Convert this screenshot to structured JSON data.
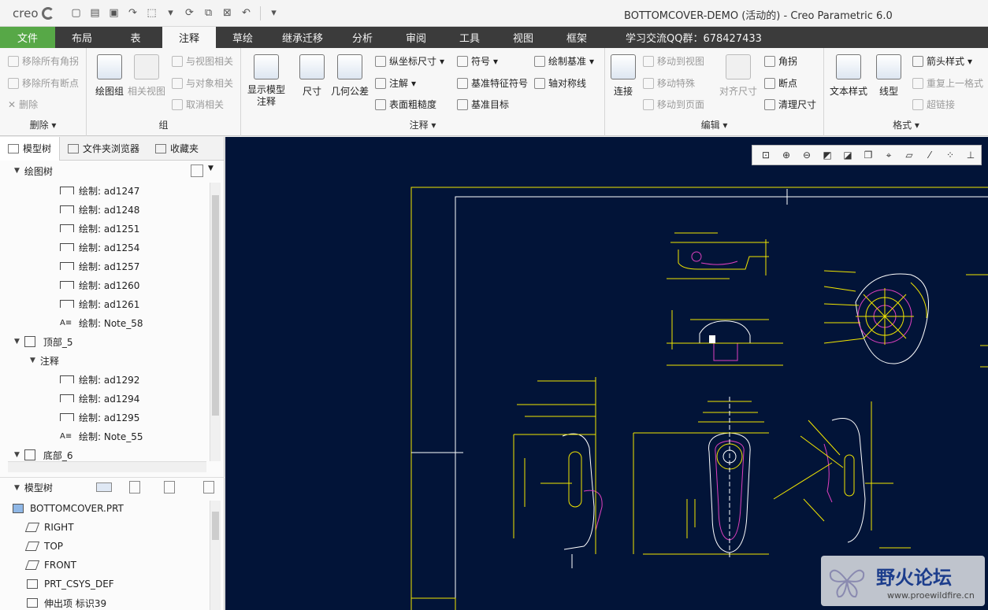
{
  "titlebar": {
    "logo": "creo",
    "title": "BOTTOMCOVER-DEMO (活动的) - Creo Parametric 6.0"
  },
  "tabs": [
    {
      "label": "文件"
    },
    {
      "label": "布局"
    },
    {
      "label": "表"
    },
    {
      "label": "注释"
    },
    {
      "label": "草绘"
    },
    {
      "label": "继承迁移"
    },
    {
      "label": "分析"
    },
    {
      "label": "审阅"
    },
    {
      "label": "工具"
    },
    {
      "label": "视图"
    },
    {
      "label": "框架"
    }
  ],
  "qq_group": "学习交流QQ群：678427433",
  "ribbon": {
    "delete": {
      "label": "删除",
      "items": [
        "移除所有角拐",
        "移除所有断点",
        "删除"
      ]
    },
    "group": {
      "label": "组",
      "draw_group": "绘图组",
      "related_view": "相关视图",
      "items": [
        "与视图相关",
        "与对象相关",
        "取消相关"
      ]
    },
    "annotate": {
      "label": "注释",
      "show_model": "显示模型注释",
      "dimension": "尺寸",
      "gtol": "几何公差",
      "items": [
        "纵坐标尺寸",
        "注解",
        "表面粗糙度",
        "符号",
        "基准特征符号",
        "基准目标",
        "绘制基准",
        "轴对称线"
      ]
    },
    "edit": {
      "label": "编辑",
      "connect": "连接",
      "items": [
        "移动到视图",
        "移动特殊",
        "移动到页面"
      ],
      "align_dim": "对齐尺寸",
      "items2": [
        "角拐",
        "断点",
        "清理尺寸"
      ]
    },
    "format": {
      "label": "格式",
      "text_style": "文本样式",
      "line_style": "线型",
      "items": [
        "箭头样式",
        "重复上一格式",
        "超链接"
      ]
    }
  },
  "left_panel": {
    "tabs": [
      "模型树",
      "文件夹浏览器",
      "收藏夹"
    ],
    "drawing_tree_title": "绘图树",
    "drawing_tree": [
      {
        "label": "绘制: ad1247",
        "type": "dim"
      },
      {
        "label": "绘制: ad1248",
        "type": "dim"
      },
      {
        "label": "绘制: ad1251",
        "type": "dim"
      },
      {
        "label": "绘制: ad1254",
        "type": "dim"
      },
      {
        "label": "绘制: ad1257",
        "type": "dim"
      },
      {
        "label": "绘制: ad1260",
        "type": "dim"
      },
      {
        "label": "绘制: ad1261",
        "type": "dim"
      },
      {
        "label": "绘制: Note_58",
        "type": "note"
      },
      {
        "label": "顶部_5",
        "type": "view"
      },
      {
        "label": "注释",
        "type": "folder"
      },
      {
        "label": "绘制: ad1292",
        "type": "dim"
      },
      {
        "label": "绘制: ad1294",
        "type": "dim"
      },
      {
        "label": "绘制: ad1295",
        "type": "dim"
      },
      {
        "label": "绘制: Note_55",
        "type": "note"
      },
      {
        "label": "底部_6",
        "type": "view"
      }
    ],
    "model_tree_title": "模型树",
    "model_tree": [
      {
        "label": "BOTTOMCOVER.PRT"
      },
      {
        "label": "RIGHT"
      },
      {
        "label": "TOP"
      },
      {
        "label": "FRONT"
      },
      {
        "label": "PRT_CSYS_DEF"
      },
      {
        "label": "伸出项 标识39"
      }
    ]
  },
  "watermark": {
    "main": "野火论坛",
    "sub": "www.proewildfire.cn"
  },
  "colors": {
    "file_tab": "#57a847",
    "canvas_bg": "#021438",
    "draw_yellow": "#f2e600",
    "draw_magenta": "#e040c0",
    "draw_white": "#ffffff"
  }
}
